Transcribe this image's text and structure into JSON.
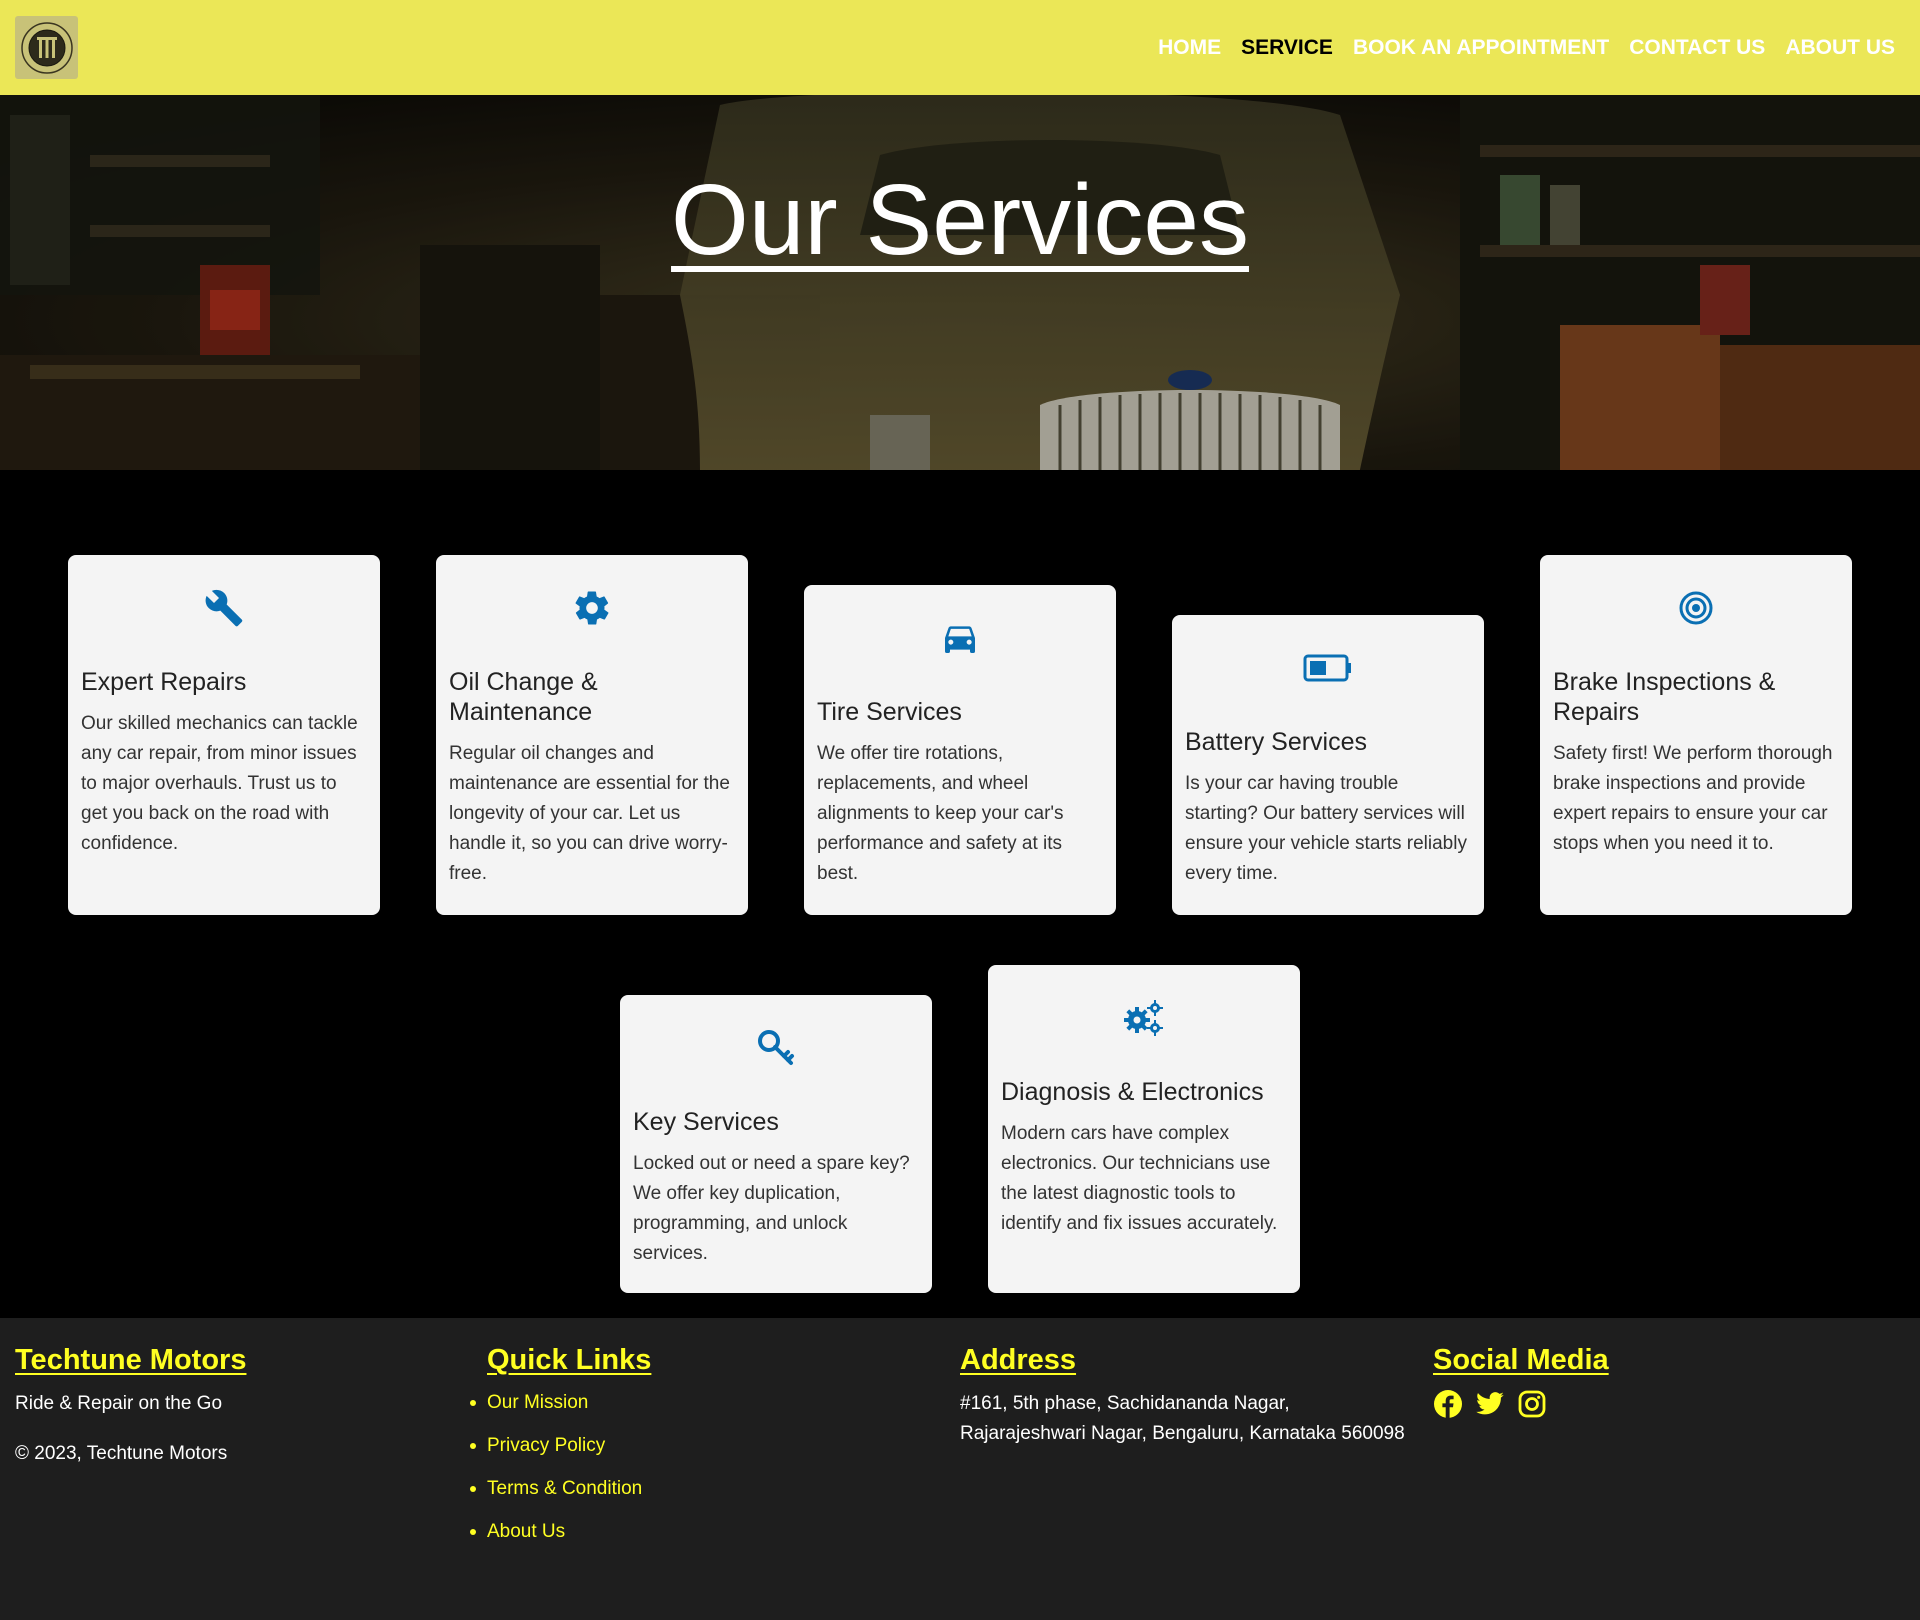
{
  "header": {
    "logo_label": "Techtune Motors logo",
    "nav": [
      {
        "label": "HOME",
        "active": false
      },
      {
        "label": "SERVICE",
        "active": true
      },
      {
        "label": "BOOK AN APPOINTMENT",
        "active": false
      },
      {
        "label": "CONTACT US",
        "active": false
      },
      {
        "label": "ABOUT US",
        "active": false
      }
    ]
  },
  "hero": {
    "title": "Our Services"
  },
  "services": [
    {
      "icon": "wrench-icon",
      "title": "Expert Repairs",
      "text": "Our skilled mechanics can tackle any car repair, from minor issues to major overhauls. Trust us to get you back on the road with confidence."
    },
    {
      "icon": "gear-icon",
      "title": "Oil Change & Maintenance",
      "text": "Regular oil changes and maintenance are essential for the longevity of your car. Let us handle it, so you can drive worry-free."
    },
    {
      "icon": "car-icon",
      "title": "Tire Services",
      "text": "We offer tire rotations, replacements, and wheel alignments to keep your car's performance and safety at its best."
    },
    {
      "icon": "battery-icon",
      "title": "Battery Services",
      "text": "Is your car having trouble starting? Our battery services will ensure your vehicle starts reliably every time."
    },
    {
      "icon": "target-icon",
      "title": "Brake Inspections & Repairs",
      "text": "Safety first! We perform thorough brake inspections and provide expert repairs to ensure your car stops when you need it to."
    },
    {
      "icon": "key-icon",
      "title": "Key Services",
      "text": "Locked out or need a spare key? We offer key duplication, programming, and unlock services."
    },
    {
      "icon": "gears-icon",
      "title": "Diagnosis & Electronics",
      "text": "Modern cars have complex electronics. Our technicians use the latest diagnostic tools to identify and fix issues accurately."
    }
  ],
  "footer": {
    "brand": {
      "title": "Techtune Motors",
      "tagline": "Ride & Repair on the Go",
      "copyright": "© 2023, Techtune Motors"
    },
    "quick_links": {
      "title": "Quick Links",
      "items": [
        "Our Mission",
        "Privacy Policy",
        "Terms & Condition",
        "About Us"
      ]
    },
    "address": {
      "title": "Address",
      "line1": "#161, 5th phase, Sachidananda Nagar,",
      "line2": "Rajarajeshwari Nagar, Bengaluru, Karnataka 560098"
    },
    "social": {
      "title": "Social Media",
      "icons": [
        "facebook-icon",
        "twitter-icon",
        "instagram-icon"
      ]
    }
  },
  "colors": {
    "header_bg": "#ebe757",
    "accent_yellow": "#ffff22",
    "icon_blue": "#0a6fb3",
    "card_bg": "#f4f4f4",
    "footer_bg": "#1e1e1e"
  }
}
